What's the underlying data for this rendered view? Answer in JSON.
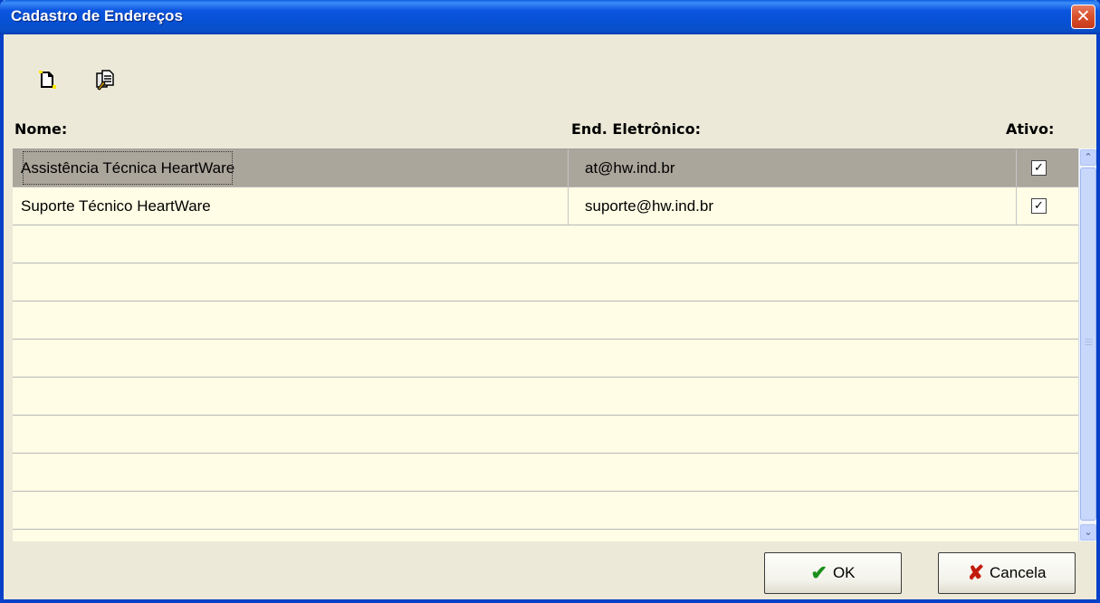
{
  "window": {
    "title": "Cadastro de Endereços",
    "close_glyph": "✕"
  },
  "toolbar": {
    "items": [
      {
        "icon": "new-document-icon"
      },
      {
        "icon": "edit-document-icon"
      }
    ]
  },
  "table": {
    "headers": {
      "name": "Nome:",
      "email": "End. Eletrônico:",
      "active": "Ativo:"
    },
    "rows": [
      {
        "name": "Assistência Técnica HeartWare",
        "email": "at@hw.ind.br",
        "active": true,
        "selected": true
      },
      {
        "name": "Suporte Técnico HeartWare",
        "email": "suporte@hw.ind.br",
        "active": true,
        "selected": false
      }
    ],
    "empty_rows": 8
  },
  "buttons": {
    "ok_label": "OK",
    "ok_icon": "✔",
    "cancel_label": "Cancela",
    "cancel_icon": "✘"
  },
  "colors": {
    "selected_row": "#aba69b",
    "grid_background": "#fffde5",
    "titlebar": "#0751d6"
  }
}
